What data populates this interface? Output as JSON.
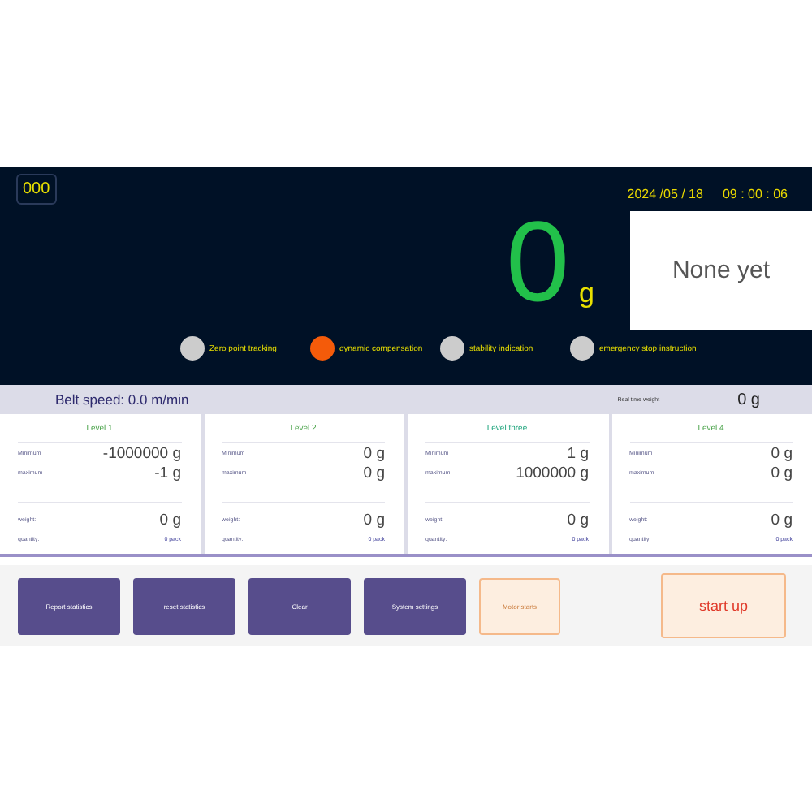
{
  "header": {
    "code": "000",
    "date": "2024 /05 / 18",
    "time": "09 : 00 : 06"
  },
  "weight": {
    "value": "0",
    "unit": "g"
  },
  "result": "None yet",
  "indicators": [
    {
      "label": "Zero point tracking",
      "on": false
    },
    {
      "label": "dynamic compensation",
      "on": true
    },
    {
      "label": "stability indication",
      "on": false
    },
    {
      "label": "emergency stop instruction",
      "on": false
    }
  ],
  "status": {
    "belt_speed": "Belt speed: 0.0 m/min",
    "realtime_label": "Real time weight",
    "realtime_value": "0 g"
  },
  "levels": [
    {
      "title": "Level 1",
      "min_label": "Minimum",
      "min": "-1000000 g",
      "max_label": "maximum",
      "max": "-1 g",
      "weight_label": "weight:",
      "weight": "0 g",
      "quantity_label": "quantity:",
      "quantity": "0 pack"
    },
    {
      "title": "Level 2",
      "min_label": "Minimum",
      "min": "0 g",
      "max_label": "maximum",
      "max": "0 g",
      "weight_label": "weight:",
      "weight": "0 g",
      "quantity_label": "quantity:",
      "quantity": "0 pack"
    },
    {
      "title": "Level three",
      "min_label": "Minimum",
      "min": "1 g",
      "max_label": "maximum",
      "max": "1000000 g",
      "weight_label": "weight:",
      "weight": "0 g",
      "quantity_label": "quantity:",
      "quantity": "0 pack"
    },
    {
      "title": "Level 4",
      "min_label": "Minimum",
      "min": "0 g",
      "max_label": "maximum",
      "max": "0 g",
      "weight_label": "weight:",
      "weight": "0 g",
      "quantity_label": "quantity:",
      "quantity": "0 pack"
    }
  ],
  "buttons": [
    {
      "label": "Report statistics",
      "kind": "primary"
    },
    {
      "label": "reset statistics",
      "kind": "primary"
    },
    {
      "label": "Clear",
      "kind": "primary"
    },
    {
      "label": "System settings",
      "kind": "primary"
    },
    {
      "label": "Motor starts",
      "kind": "secondary"
    }
  ],
  "start_button": "start up"
}
